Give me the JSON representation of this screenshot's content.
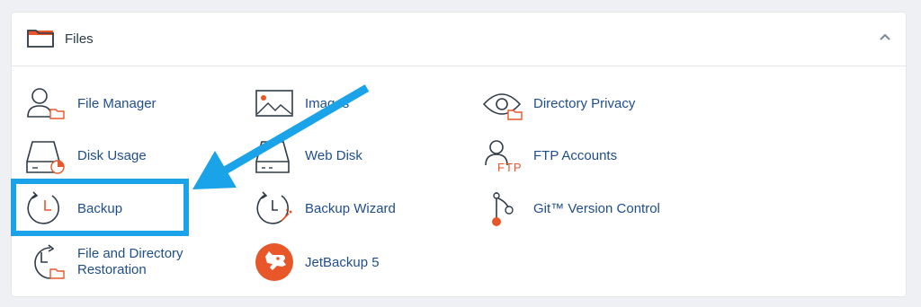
{
  "section": {
    "title": "Files",
    "icon": "folder-icon",
    "collapse_icon": "chevron-up-icon"
  },
  "items": [
    {
      "label": "File Manager",
      "icon": "file-manager-icon"
    },
    {
      "label": "Images",
      "icon": "images-icon"
    },
    {
      "label": "Directory Privacy",
      "icon": "directory-privacy-icon"
    },
    {
      "label": "Disk Usage",
      "icon": "disk-usage-icon"
    },
    {
      "label": "Web Disk",
      "icon": "web-disk-icon"
    },
    {
      "label": "FTP Accounts",
      "icon": "ftp-accounts-icon",
      "icon_text": "FTP"
    },
    {
      "label": "Backup",
      "icon": "backup-icon"
    },
    {
      "label": "Backup Wizard",
      "icon": "backup-wizard-icon"
    },
    {
      "label": "Git™ Version Control",
      "icon": "git-icon"
    },
    {
      "label_line1": "File and Directory",
      "label_line2": "Restoration",
      "icon": "restoration-icon"
    },
    {
      "label": "JetBackup 5",
      "icon": "jetbackup-icon"
    }
  ],
  "annotation": {
    "arrow": "blue-arrow-pointer",
    "highlight_target": "Backup",
    "color": "#1aa3e8"
  },
  "colors": {
    "link": "#1f4e8c",
    "icon_stroke": "#2f3b48",
    "accent_orange": "#e8572a",
    "highlight_blue": "#1aa3e8"
  }
}
